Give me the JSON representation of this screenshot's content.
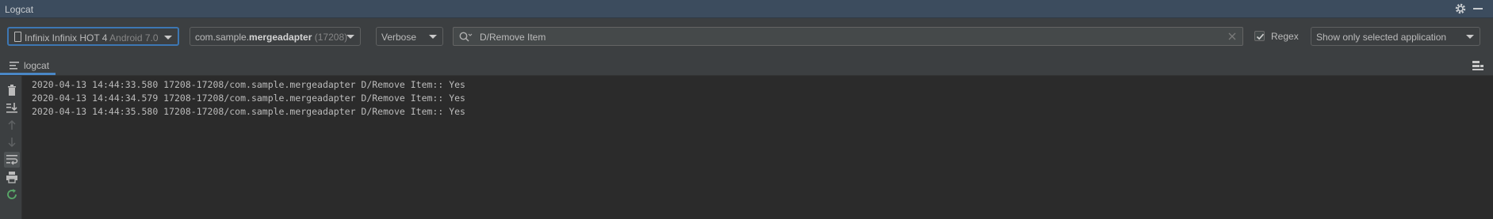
{
  "title": "Logcat",
  "toolbar": {
    "device": {
      "name": "Infinix Infinix HOT 4",
      "version": "Android 7.0"
    },
    "process": {
      "prefix": "com.sample.",
      "bold": "mergeadapter",
      "pid": "(17208)"
    },
    "log_level": "Verbose",
    "search": {
      "value": "D/Remove Item"
    },
    "regex": {
      "label": "Regex",
      "checked": true
    },
    "filter": "Show only selected application"
  },
  "tab": {
    "label": "logcat"
  },
  "sidebar": {
    "icons": [
      "trash-icon",
      "scroll-to-end-icon",
      "up-arrow-icon",
      "down-arrow-icon",
      "soft-wrap-icon",
      "print-icon",
      "restart-icon"
    ]
  },
  "log": {
    "lines": [
      "2020-04-13 14:44:33.580 17208-17208/com.sample.mergeadapter D/Remove Item:: Yes",
      "2020-04-13 14:44:34.579 17208-17208/com.sample.mergeadapter D/Remove Item:: Yes",
      "2020-04-13 14:44:35.580 17208-17208/com.sample.mergeadapter D/Remove Item:: Yes"
    ]
  },
  "colors": {
    "title_bar": "#3c4c5e",
    "panel": "#3c3f41",
    "background": "#2b2b2b",
    "focus_border": "#3d77b3",
    "text": "#bbbbbb"
  }
}
